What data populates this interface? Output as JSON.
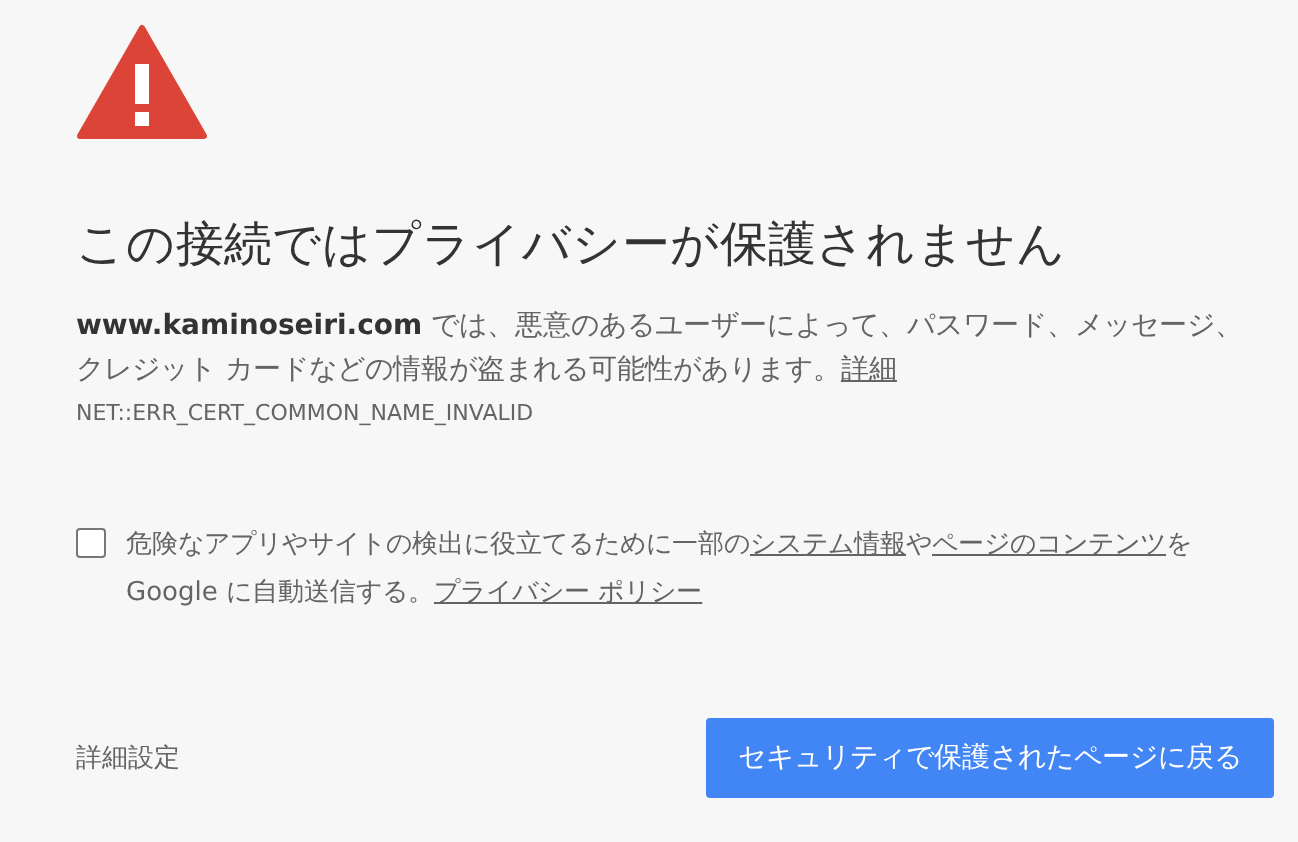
{
  "heading": "この接続ではプライバシーが保護されません",
  "message": {
    "text": "**www.kaminoseiri.com** では、悪意のあるユーザーによって、パスワード、メッセージ、クレジット カードなどの情報が盗まれる可能性があります。",
    "link": "詳細"
  },
  "error_code": "NET::ERR_CERT_COMMON_NAME_INVALID",
  "report_option": {
    "checked": false,
    "parts": [
      {
        "kind": "text",
        "text": "危険なアプリやサイトの検出に役立てるために一部の"
      },
      {
        "kind": "link",
        "text": "システム情報"
      },
      {
        "kind": "text",
        "text": "や"
      },
      {
        "kind": "link",
        "text": "ページのコンテンツ"
      },
      {
        "kind": "text",
        "text": "を Google に自動送信する。"
      },
      {
        "kind": "link",
        "text": "プライバシー ポリシー"
      }
    ]
  },
  "advanced_button": "詳細設定",
  "back_button": "セキュリティで保護されたページに戻る"
}
